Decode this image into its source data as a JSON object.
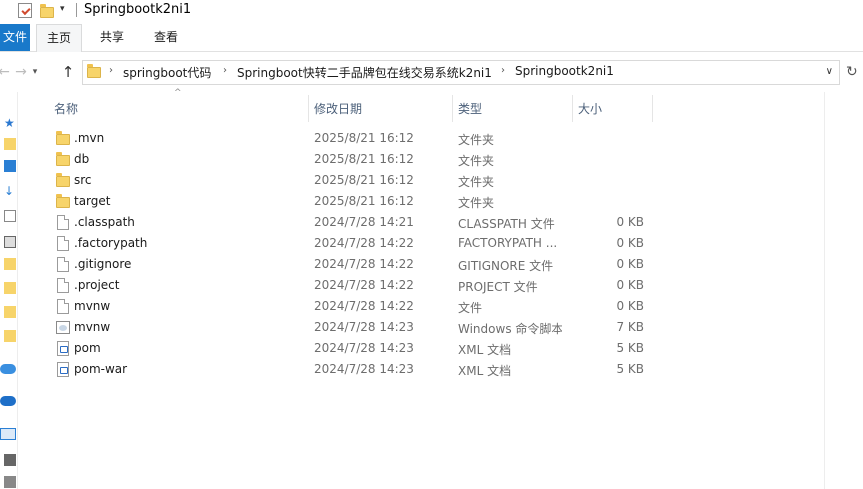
{
  "window": {
    "title": "Springbootk2ni1",
    "quick_access": {
      "properties_icon": "properties-icon",
      "folder_icon": "new-folder-icon",
      "dropdown_glyph": "▾"
    }
  },
  "ribbon": {
    "tabs": [
      {
        "label": "文件"
      },
      {
        "label": "主页"
      },
      {
        "label": "共享"
      },
      {
        "label": "查看"
      }
    ],
    "active_color": "#1979ca"
  },
  "nav": {
    "back_glyph": "←",
    "forward_glyph": "→",
    "recent_glyph": "▾",
    "up_glyph": "↑",
    "refresh_glyph": "↻",
    "history_glyph": "∨"
  },
  "address": {
    "separator": "›",
    "crumbs": [
      "springboot代码",
      "Springboot快转二手品牌包在线交易系统k2ni1",
      "Springbootk2ni1"
    ]
  },
  "columns": {
    "name": "名称",
    "date": "修改日期",
    "type": "类型",
    "size": "大小",
    "sort_glyph": "^"
  },
  "files": [
    {
      "name": ".mvn",
      "date": "2025/8/21 16:12",
      "type": "文件夹",
      "size": "",
      "icon": "folder-icon"
    },
    {
      "name": "db",
      "date": "2025/8/21 16:12",
      "type": "文件夹",
      "size": "",
      "icon": "folder-icon"
    },
    {
      "name": "src",
      "date": "2025/8/21 16:12",
      "type": "文件夹",
      "size": "",
      "icon": "folder-icon"
    },
    {
      "name": "target",
      "date": "2025/8/21 16:12",
      "type": "文件夹",
      "size": "",
      "icon": "folder-icon"
    },
    {
      "name": ".classpath",
      "date": "2024/7/28 14:21",
      "type": "CLASSPATH 文件",
      "size": "0 KB",
      "icon": "file-icon"
    },
    {
      "name": ".factorypath",
      "date": "2024/7/28 14:22",
      "type": "FACTORYPATH ...",
      "size": "0 KB",
      "icon": "file-icon"
    },
    {
      "name": ".gitignore",
      "date": "2024/7/28 14:22",
      "type": "GITIGNORE 文件",
      "size": "0 KB",
      "icon": "file-icon"
    },
    {
      "name": ".project",
      "date": "2024/7/28 14:22",
      "type": "PROJECT 文件",
      "size": "0 KB",
      "icon": "file-icon"
    },
    {
      "name": "mvnw",
      "date": "2024/7/28 14:22",
      "type": "文件",
      "size": "0 KB",
      "icon": "file-icon"
    },
    {
      "name": "mvnw",
      "date": "2024/7/28 14:23",
      "type": "Windows 命令脚本",
      "size": "7 KB",
      "icon": "cmd-script-icon"
    },
    {
      "name": "pom",
      "date": "2024/7/28 14:23",
      "type": "XML 文档",
      "size": "5 KB",
      "icon": "xml-document-icon"
    },
    {
      "name": "pom-war",
      "date": "2024/7/28 14:23",
      "type": "XML 文档",
      "size": "5 KB",
      "icon": "xml-document-icon"
    }
  ],
  "colors": {
    "folder": "#f7d46a",
    "header_text": "#4c607a",
    "ribbon_file_bg": "#1979ca"
  }
}
